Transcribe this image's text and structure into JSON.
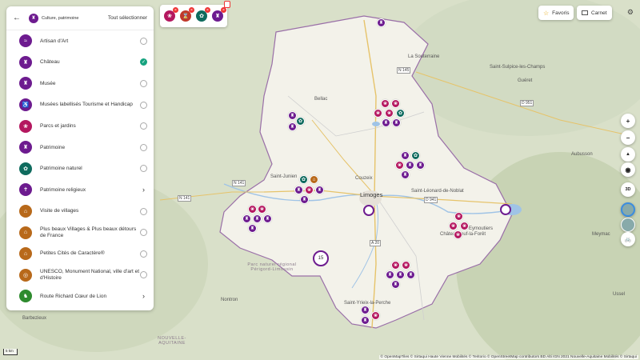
{
  "panel": {
    "category_title": "Culture, patrimoine",
    "select_all": "Tout sélectionner",
    "items": [
      {
        "label": "Artisan d'Art",
        "color": "#6d1b8f",
        "icon": "artisan-icon",
        "state": "off"
      },
      {
        "label": "Château",
        "color": "#6d1b8f",
        "icon": "castle-icon",
        "state": "on"
      },
      {
        "label": "Musée",
        "color": "#6d1b8f",
        "icon": "museum-icon",
        "state": "off"
      },
      {
        "label": "Musées labellisés Tourisme et Handicap",
        "color": "#6d1b8f",
        "icon": "accessible-museum-icon",
        "state": "off"
      },
      {
        "label": "Parcs et jardins",
        "color": "#b4175f",
        "icon": "garden-icon",
        "state": "off"
      },
      {
        "label": "Patrimoine",
        "color": "#6d1b8f",
        "icon": "heritage-icon",
        "state": "off"
      },
      {
        "label": "Patrimoine naturel",
        "color": "#0f6b5e",
        "icon": "nature-icon",
        "state": "off"
      },
      {
        "label": "Patrimoine religieux",
        "color": "#6d1b8f",
        "icon": "church-icon",
        "state": "chevron"
      },
      {
        "label": "Visite de villages",
        "color": "#b8691a",
        "icon": "village-icon",
        "state": "off"
      },
      {
        "label": "Plus beaux Villages & Plus beaux détours de France",
        "color": "#b8691a",
        "icon": "village-label-icon",
        "state": "off"
      },
      {
        "label": "Petites Cités de Caractère®",
        "color": "#b8691a",
        "icon": "city-icon",
        "state": "off"
      },
      {
        "label": "UNESCO, Monument National, ville d'art et d'Histoire",
        "color": "#b8691a",
        "icon": "unesco-icon",
        "state": "off"
      },
      {
        "label": "Route Richard Cœur de Lion",
        "color": "#2e8b2e",
        "icon": "route-icon",
        "state": "chevron"
      }
    ]
  },
  "chips": [
    {
      "color": "#b4175f",
      "icon": "garden-icon"
    },
    {
      "color": "#c0392b",
      "icon": "history-icon"
    },
    {
      "color": "#0f6b5e",
      "icon": "nature-icon"
    },
    {
      "color": "#6d1b8f",
      "icon": "castle-icon"
    }
  ],
  "toolbar": {
    "favorites": "Favoris",
    "notebook": "Carnet"
  },
  "controls": {
    "zoom_in": "+",
    "zoom_out": "−",
    "north": "▲",
    "view": "◉",
    "mode_3d": "3D",
    "bike": "🚲"
  },
  "map": {
    "places": [
      "La Souterraine",
      "Bellac",
      "Guéret",
      "Saint-Sulpice-les-Champs",
      "Aubusson",
      "Saint-Junien",
      "Couzeix",
      "Limoges",
      "Saint-Léonard-de-Noblat",
      "Châteauneuf-la-Forêt",
      "Eymoutiers",
      "Saint-Yrieix-la-Perche",
      "Ussel",
      "Nontron",
      "Barbezieux",
      "Meymac"
    ],
    "roads": [
      "N 145",
      "D 951",
      "D 941",
      "N 141",
      "N 141",
      "A 20"
    ],
    "regions": [
      "Parc naturel régional Périgord-Limousin",
      "NOUVELLE-AQUITAINE"
    ],
    "cluster_count": "15"
  },
  "scale": "5 km",
  "attribution": "© OpenMapTiles © Sirtaqui Haute Vienne Mobilités © Teritorio © OpenStreetMap contributors BD Alti IGN 2021 Nouvelle-Aquitaine Mobilités © Sirtaqui"
}
